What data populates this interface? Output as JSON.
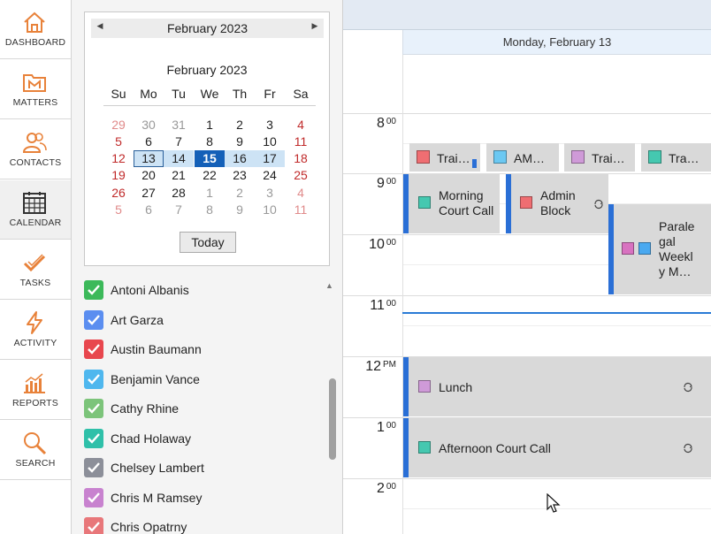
{
  "nav": {
    "items": [
      {
        "label": "DASHBOARD",
        "icon": "house-icon"
      },
      {
        "label": "MATTERS",
        "icon": "folder-m-icon"
      },
      {
        "label": "CONTACTS",
        "icon": "people-icon"
      },
      {
        "label": "CALENDAR",
        "icon": "calendar-icon"
      },
      {
        "label": "TASKS",
        "icon": "check-icon"
      },
      {
        "label": "ACTIVITY",
        "icon": "lightning-icon"
      },
      {
        "label": "REPORTS",
        "icon": "bar-chart-icon"
      },
      {
        "label": "SEARCH",
        "icon": "magnifier-icon"
      }
    ],
    "active": "CALENDAR",
    "accent": "#e8823a"
  },
  "mini_calendar": {
    "header_title": "February 2023",
    "month_title": "February 2023",
    "dow": [
      "Su",
      "Mo",
      "Tu",
      "We",
      "Th",
      "Fr",
      "Sa"
    ],
    "weeks": [
      [
        "29",
        "30",
        "31",
        "1",
        "2",
        "3",
        "4"
      ],
      [
        "5",
        "6",
        "7",
        "8",
        "9",
        "10",
        "11"
      ],
      [
        "12",
        "13",
        "14",
        "15",
        "16",
        "17",
        "18"
      ],
      [
        "19",
        "20",
        "21",
        "22",
        "23",
        "24",
        "25"
      ],
      [
        "26",
        "27",
        "28",
        "1",
        "2",
        "3",
        "4"
      ],
      [
        "5",
        "6",
        "7",
        "8",
        "9",
        "10",
        "11"
      ]
    ],
    "today_label": "Today"
  },
  "people": [
    {
      "name": "Antoni Albanis",
      "color": "#3cb95a"
    },
    {
      "name": "Art Garza",
      "color": "#5b8ef0"
    },
    {
      "name": "Austin Baumann",
      "color": "#e8474e"
    },
    {
      "name": "Benjamin Vance",
      "color": "#4fb7ee"
    },
    {
      "name": "Cathy Rhine",
      "color": "#7cc47a"
    },
    {
      "name": "Chad Holaway",
      "color": "#2fc0a9"
    },
    {
      "name": "Chelsey Lambert",
      "color": "#8c8f99"
    },
    {
      "name": "Chris M Ramsey",
      "color": "#c882cf"
    },
    {
      "name": "Chris Opatrny",
      "color": "#e8777a"
    }
  ],
  "day_view": {
    "header": "Monday, February 13",
    "hours": [
      {
        "h": "8",
        "m": "00"
      },
      {
        "h": "9",
        "m": "00"
      },
      {
        "h": "10",
        "m": "00"
      },
      {
        "h": "11",
        "m": "00"
      },
      {
        "h": "12",
        "m": "PM"
      },
      {
        "h": "1",
        "m": "00"
      },
      {
        "h": "2",
        "m": "00"
      }
    ],
    "all_day": [
      {
        "label": "Trai…",
        "color": "#ef6e72"
      },
      {
        "label": "AM…",
        "color": "#6bc8f2"
      },
      {
        "label": "Trai…",
        "color": "#cf9ad8"
      },
      {
        "label": "Tra…",
        "color": "#45c8b0"
      }
    ],
    "events": {
      "morning_court": {
        "line1": "Morning",
        "line2": "Court Call",
        "color": "#45c8b0"
      },
      "admin_block": {
        "line1": "Admin",
        "line2": "Block",
        "color": "#ef6e72"
      },
      "paralegal": {
        "line1": "Parale",
        "line2": "gal",
        "line3": "Weekl",
        "line4": "y M…",
        "color1": "#d872c0",
        "color2": "#4aa9f0"
      },
      "lunch": {
        "label": "Lunch",
        "color": "#cf9ad8"
      },
      "afternoon": {
        "label": "Afternoon Court Call",
        "color": "#45c8b0"
      }
    },
    "bar_color": "#2a6fd6"
  }
}
